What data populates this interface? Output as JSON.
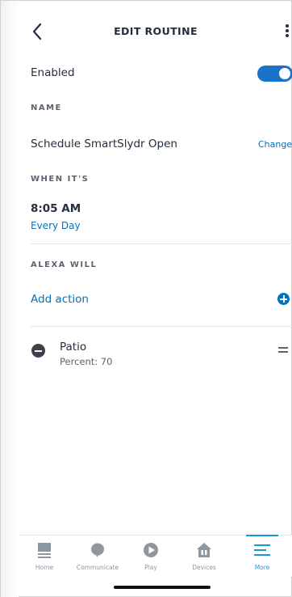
{
  "header": {
    "title": "EDIT ROUTINE"
  },
  "enabled": {
    "label": "Enabled",
    "state": true
  },
  "name_section": {
    "label": "NAME",
    "value": "Schedule SmartSlydr Open",
    "change_label": "Change"
  },
  "when_section": {
    "label": "WHEN IT'S",
    "time": "8:05 AM",
    "recurrence": "Every Day"
  },
  "alexa_section": {
    "label": "ALEXA WILL",
    "add_action_label": "Add action",
    "actions": [
      {
        "title": "Patio",
        "subtitle": "Percent: 70"
      }
    ]
  },
  "tabbar": {
    "items": [
      {
        "label": "Home",
        "icon": "home-icon",
        "active": false
      },
      {
        "label": "Communicate",
        "icon": "speech-bubble-icon",
        "active": false
      },
      {
        "label": "Play",
        "icon": "play-icon",
        "active": false
      },
      {
        "label": "Devices",
        "icon": "devices-house-icon",
        "active": false
      },
      {
        "label": "More",
        "icon": "menu-icon",
        "active": true
      }
    ]
  },
  "colors": {
    "accent": "#0073bb",
    "toggle": "#1a73c8",
    "active_tab": "#1a98d5",
    "text": "#232f3e"
  }
}
